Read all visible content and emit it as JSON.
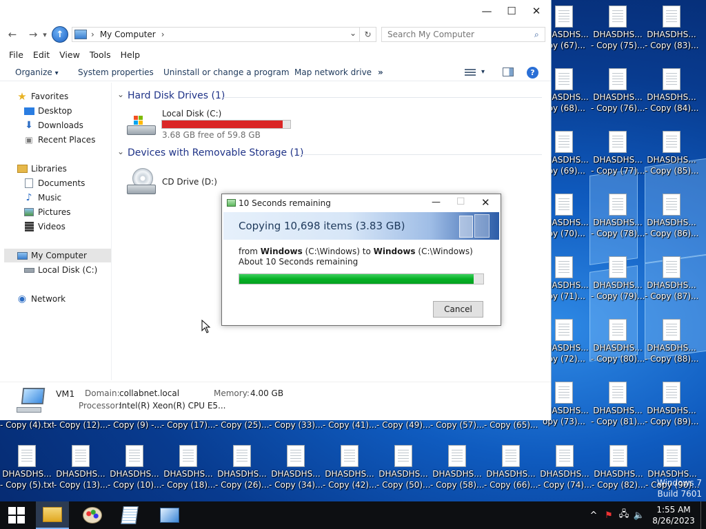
{
  "explorer": {
    "nav": {
      "back": "←",
      "forward": "→",
      "recent": "▾",
      "up": "↑"
    },
    "address": {
      "computer_glyph": "🖥",
      "sep1": "›",
      "location": "My Computer",
      "sep2": "›",
      "dropdown": "⌄",
      "refresh": "↻"
    },
    "search_placeholder": "Search My Computer",
    "search_glyph": "⌕",
    "window_controls": {
      "minimize": "—",
      "maximize": "☐",
      "close": "✕"
    },
    "menu": [
      "File",
      "Edit",
      "View",
      "Tools",
      "Help"
    ],
    "commands": {
      "organize": "Organize",
      "organize_arrow": "▾",
      "system_properties": "System properties",
      "uninstall": "Uninstall or change a program",
      "map_drive": "Map network drive",
      "more": "»",
      "view_arrow": "▾",
      "help": "?"
    },
    "sidebar": {
      "favorites": "Favorites",
      "desktop": "Desktop",
      "downloads": "Downloads",
      "recent_places": "Recent Places",
      "libraries": "Libraries",
      "documents": "Documents",
      "music": "Music",
      "pictures": "Pictures",
      "videos": "Videos",
      "my_computer": "My Computer",
      "local_disk": "Local Disk (C:)",
      "network": "Network"
    },
    "groups": {
      "collapse_glyph": "⌄",
      "hard_disk": "Hard Disk Drives (1)",
      "removable": "Devices with Removable Storage (1)"
    },
    "drives": {
      "c_name": "Local Disk (C:)",
      "c_free": "3.68 GB free of 59.8 GB",
      "c_used_fraction": 0.94,
      "d_name": "CD Drive (D:)"
    },
    "details": {
      "name": "VM1",
      "domain_label": "Domain:",
      "domain": "collabnet.local",
      "memory_label": "Memory:",
      "memory": "4.00 GB",
      "processor_label": "Processor:",
      "processor": "Intel(R) Xeon(R) CPU E5..."
    }
  },
  "dialog": {
    "title": "10 Seconds remaining",
    "heading": "Copying 10,698 items (3.83 GB)",
    "from_prefix": "from ",
    "from_name": "Windows",
    "from_path": " (C:\\Windows) to ",
    "to_name": "Windows",
    "to_path": " (C:\\Windows)",
    "status": "About 10 Seconds remaining",
    "progress_fraction": 0.96,
    "cancel": "Cancel",
    "min_glyph": "—",
    "max_glyph": "☐",
    "close_glyph": "✕"
  },
  "desktop": {
    "icon_name": "DHASDHS...",
    "col1": [
      "opy (67)...",
      "opy (68)...",
      "opy (69)...",
      "opy (70)...",
      "opy (71)...",
      "opy (72)...",
      "opy (73)..."
    ],
    "col2": [
      "- Copy (75)...",
      "- Copy (76)...",
      "- Copy (77)...",
      "- Copy (78)...",
      "- Copy (79)...",
      "- Copy (80)...",
      "- Copy (81)..."
    ],
    "col3": [
      "- Copy (83)...",
      "- Copy (84)...",
      "- Copy (85)...",
      "- Copy (86)...",
      "- Copy (87)...",
      "- Copy (88)...",
      "- Copy (89)..."
    ],
    "behind_row": [
      "- Copy (4).txt",
      "- Copy (12)...",
      "- Copy (9) -...",
      "- Copy (17)...",
      "- Copy (25)...",
      "- Copy (33)...",
      "- Copy (41)...",
      "- Copy (49)...",
      "- Copy (57)...",
      "- Copy (65)..."
    ],
    "bottom_row": [
      "- Copy (5).txt",
      "- Copy (13)...",
      "- Copy (10)...",
      "- Copy (18)...",
      "- Copy (26)...",
      "- Copy (34)...",
      "- Copy (42)...",
      "- Copy (50)...",
      "- Copy (58)...",
      "- Copy (66)...",
      "- Copy (74)...",
      "- Copy (82)...",
      "- Copy (90)..."
    ]
  },
  "watermark": {
    "line1": "Windows 7",
    "line2": "Build 7601"
  },
  "taskbar": {
    "tray_chevron": "^",
    "flag_glyph": "⚑",
    "network_glyph": "🖧",
    "volume_glyph": "🔈",
    "time": "1:55 AM",
    "date": "8/26/2023"
  }
}
